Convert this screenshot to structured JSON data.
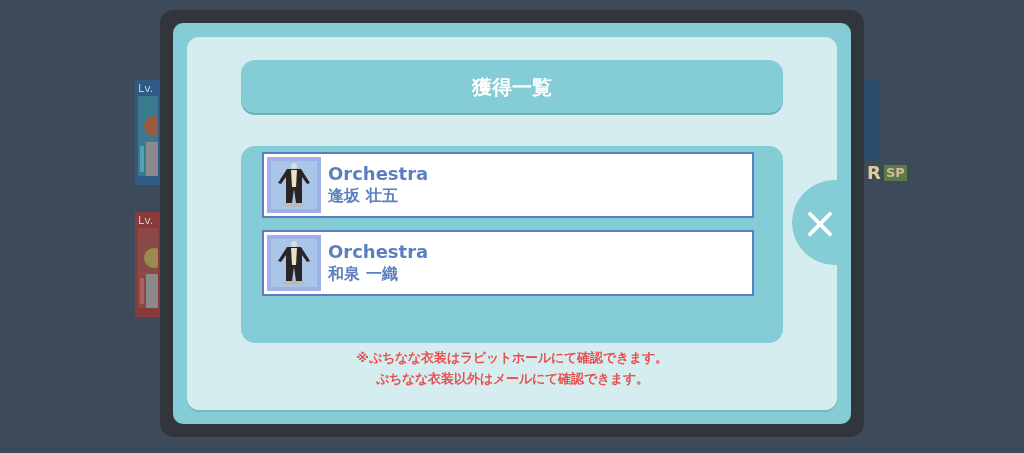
{
  "background_cards": [
    {
      "level_label": "Lv.",
      "color": "#2f5a86"
    },
    {
      "level_label": "Lv.",
      "color": "#8a3a3a"
    }
  ],
  "background_badges": [
    "R",
    "SP"
  ],
  "dialog": {
    "title": "獲得一覧",
    "items": [
      {
        "name": "Orchestra",
        "character": "逢坂 壮五"
      },
      {
        "name": "Orchestra",
        "character": "和泉 一織"
      }
    ],
    "notes": [
      "※ぷちなな衣装はラビットホールにて確認できます。",
      "ぷちなな衣装以外はメールにて確認できます。"
    ],
    "close_label": "×"
  }
}
